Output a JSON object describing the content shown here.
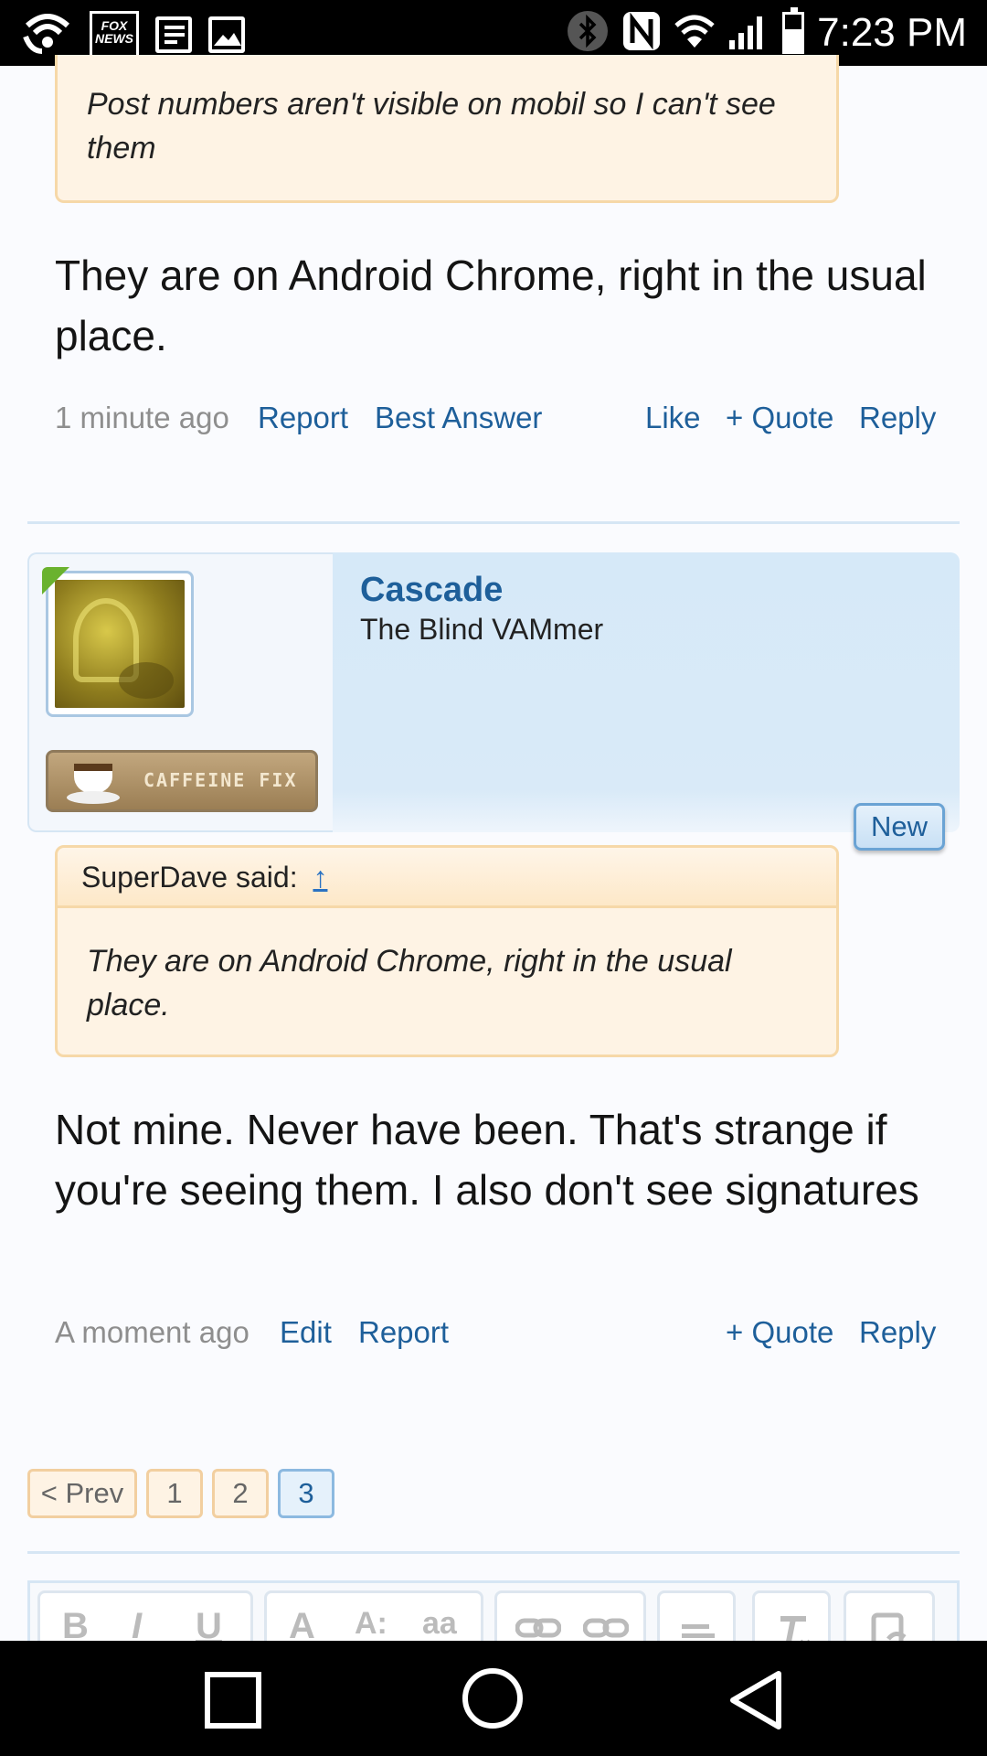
{
  "status_bar": {
    "time": "7:23 PM",
    "left_icons": [
      "wifi-call-icon",
      "fox-news-icon",
      "notes-icon",
      "image-icon"
    ],
    "right_icons": [
      "bluetooth-icon",
      "nfc-icon",
      "wifi-icon",
      "signal-icon",
      "battery-icon"
    ],
    "fox_label": "FOX NEWS"
  },
  "quote_top": {
    "text": "Post numbers aren't visible on mobil so I can't see them"
  },
  "post1": {
    "message": "They are on Android Chrome, right in the usual place.",
    "time": "1 minute ago",
    "report": "Report",
    "best_answer": "Best Answer",
    "like": "Like",
    "quote": "+ Quote",
    "reply": "Reply"
  },
  "post2": {
    "username": "Cascade",
    "user_title": "The Blind VAMmer",
    "badge": "CAFFEINE FIX",
    "new_label": "New",
    "quote_author": "SuperDave said:",
    "quote_arrow": "↑",
    "quote_text": "They are on Android Chrome, right in the usual place.",
    "message": "Not mine. Never have been. That's strange if you're seeing them. I also don't see signatures",
    "time": "A moment ago",
    "edit": "Edit",
    "report": "Report",
    "quote": "+ Quote",
    "reply": "Reply"
  },
  "pagination": {
    "prev": "< Prev",
    "pages": [
      "1",
      "2",
      "3"
    ],
    "current": "3"
  },
  "editor_toolbar": {
    "tools": [
      "B",
      "I",
      "U",
      "A",
      "A:",
      "aa",
      "link-icon",
      "unlink-icon",
      "align-icon",
      "clear-format-icon",
      "paste-icon"
    ]
  },
  "nav_bar": {
    "buttons": [
      "recent-apps-icon",
      "home-icon",
      "back-icon"
    ]
  }
}
